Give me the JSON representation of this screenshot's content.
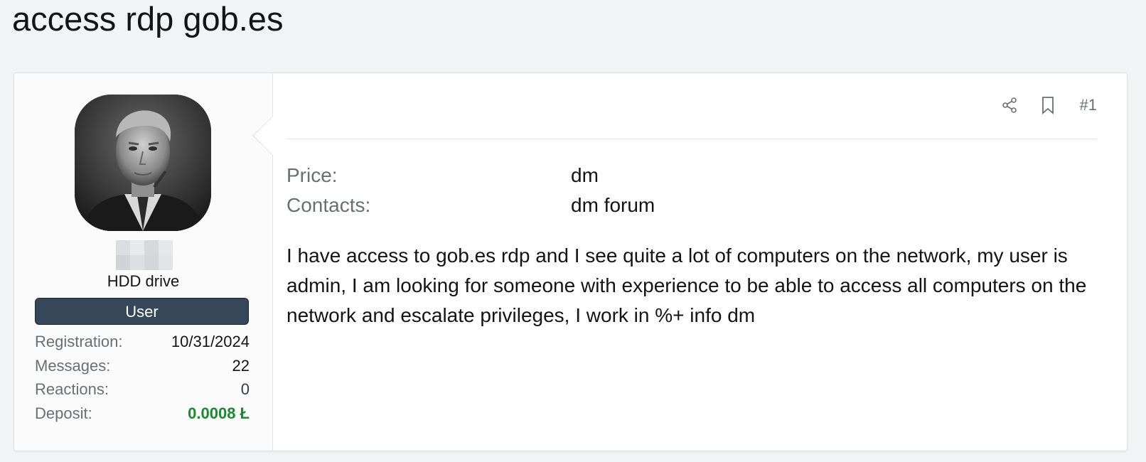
{
  "thread": {
    "title": "access rdp gob.es"
  },
  "user": {
    "title": "HDD drive",
    "role": "User",
    "stats": [
      {
        "label": "Registration:",
        "value": "10/31/2024"
      },
      {
        "label": "Messages:",
        "value": "22"
      },
      {
        "label": "Reactions:",
        "value": "0"
      },
      {
        "label": "Deposit:",
        "value": "0.0008 Ł"
      }
    ]
  },
  "post": {
    "number": "#1",
    "fields": [
      {
        "label": "Price:",
        "value": "dm"
      },
      {
        "label": "Contacts:",
        "value": "dm forum"
      }
    ],
    "body": "I have access to gob.es rdp and I see quite a lot of computers on the network, my user is admin, I am looking for someone with experience to be able to access all computers on the network and escalate privileges, I work in %+ info dm"
  },
  "icons": {
    "share": "share-icon",
    "bookmark": "bookmark-icon"
  },
  "colors": {
    "badge_bg": "#37475a",
    "deposit": "#1a8a2e",
    "page_bg": "#f2f3f5"
  }
}
